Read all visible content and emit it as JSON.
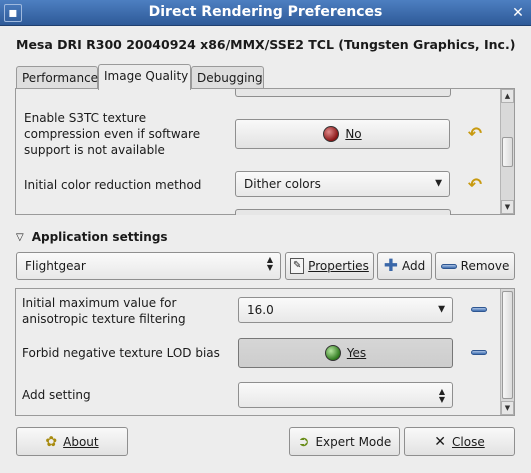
{
  "window": {
    "title": "Direct Rendering Preferences",
    "heading": "Mesa DRI R300 20040924 x86/MMX/SSE2 TCL (Tungsten Graphics, Inc.)"
  },
  "tabs": [
    {
      "label": "Performance"
    },
    {
      "label": "Image Quality",
      "active": true
    },
    {
      "label": "Debugging"
    }
  ],
  "image_quality": {
    "s3tc": {
      "label": "Enable S3TC texture compression even if software support is not available",
      "label_lines": [
        "Enable S3TC texture",
        "compression even if software",
        "support is not available"
      ],
      "value_label": "No",
      "state": "off"
    },
    "color_reduction": {
      "label": "Initial color reduction method",
      "value": "Dither colors"
    }
  },
  "application_settings": {
    "section_label": "Application settings",
    "selected_app": "Flightgear",
    "properties_button": "Properties",
    "add_button": "Add",
    "remove_button": "Remove",
    "settings": [
      {
        "label_lines": [
          "Initial maximum value for",
          "anisotropic texture filtering"
        ],
        "value": "16.0"
      },
      {
        "label": "Forbid negative texture LOD bias",
        "value_label": "Yes",
        "state": "on"
      },
      {
        "label": "Add setting",
        "value": ""
      }
    ]
  },
  "footer": {
    "about_button": "About",
    "expert_mode_button": "Expert Mode",
    "close_button": "Close"
  },
  "colors": {
    "titlebar": "#3a6aab",
    "window_bg": "#ededed",
    "undo_arrow": "#c89a10"
  }
}
